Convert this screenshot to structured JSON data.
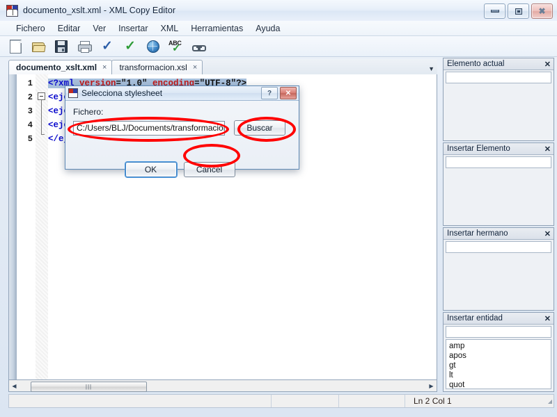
{
  "window": {
    "title": "documento_xslt.xml - XML Copy Editor",
    "app_icon": "xml-copy-editor-icon",
    "minimize_label": "Minimizar",
    "maximize_label": "Restaurar",
    "close_label": "Cerrar"
  },
  "menubar": {
    "items": [
      {
        "label": "Fichero",
        "name": "menu-fichero"
      },
      {
        "label": "Editar",
        "name": "menu-editar"
      },
      {
        "label": "Ver",
        "name": "menu-ver"
      },
      {
        "label": "Insertar",
        "name": "menu-insertar"
      },
      {
        "label": "XML",
        "name": "menu-xml"
      },
      {
        "label": "Herramientas",
        "name": "menu-herramientas"
      },
      {
        "label": "Ayuda",
        "name": "menu-ayuda"
      }
    ]
  },
  "toolbar": {
    "items": [
      {
        "icon": "new-document-icon"
      },
      {
        "icon": "open-folder-icon"
      },
      {
        "icon": "save-floppy-icon"
      },
      {
        "icon": "print-icon"
      },
      {
        "icon": "check-wellformed-icon"
      },
      {
        "icon": "check-validate-icon"
      },
      {
        "icon": "globe-preview-icon"
      },
      {
        "icon": "abc-spellcheck-icon"
      },
      {
        "icon": "link-icon"
      }
    ]
  },
  "tabs": {
    "items": [
      {
        "label": "documento_xslt.xml",
        "close": "×",
        "active": true
      },
      {
        "label": "transformacion.xsl",
        "close": "×",
        "active": false
      }
    ],
    "overflow_glyph": "▼"
  },
  "editor": {
    "line_numbers": [
      "1",
      "2",
      "3",
      "4",
      "5"
    ],
    "lines": [
      {
        "n": "1",
        "parts": [
          {
            "t": "<?xml ",
            "c": "tok-punct"
          },
          {
            "t": "version",
            "c": "tok-attr"
          },
          {
            "t": "=\"1.0\" ",
            "c": "tok-val"
          },
          {
            "t": "encoding",
            "c": "tok-attr"
          },
          {
            "t": "=\"UTF-8\"?>",
            "c": "tok-val"
          }
        ]
      },
      {
        "n": "2",
        "parts": [
          {
            "t": "<ejemplo>",
            "c": "tok-name"
          }
        ]
      },
      {
        "n": "3",
        "parts": [
          {
            "t": "  <ejem>uno</ejem>",
            "c": "tok-name"
          }
        ]
      },
      {
        "n": "4",
        "parts": [
          {
            "t": "  <ejem>dos</ejem>",
            "c": "tok-name"
          }
        ]
      },
      {
        "n": "5",
        "parts": [
          {
            "t": "</ejemplo>",
            "c": "tok-name"
          }
        ]
      }
    ],
    "fold_marker": "−",
    "scroll_left_arrow": "◀",
    "scroll_right_arrow": "▶",
    "scroll_grip": "|||"
  },
  "sidebar": {
    "panels": [
      {
        "title": "Elemento actual",
        "close": "✕",
        "name": "panel-elemento-actual",
        "has_list": false,
        "items": []
      },
      {
        "title": "Insertar Elemento",
        "close": "✕",
        "name": "panel-insertar-elemento",
        "has_list": false,
        "items": []
      },
      {
        "title": "Insertar hermano",
        "close": "✕",
        "name": "panel-insertar-hermano",
        "has_list": false,
        "items": []
      },
      {
        "title": "Insertar entidad",
        "close": "✕",
        "name": "panel-insertar-entidad",
        "has_list": true,
        "items": [
          "amp",
          "apos",
          "gt",
          "lt",
          "quot"
        ]
      }
    ]
  },
  "statusbar": {
    "cursor": "Ln 2 Col 1",
    "grip": "◢"
  },
  "dialog": {
    "title": "Selecciona stylesheet",
    "icon": "xml-copy-editor-icon",
    "help_glyph": "?",
    "close_glyph": "✕",
    "field_label": "Fichero:",
    "field_value": "C:/Users/BLJ/Documents/transformacion.xsl",
    "field_placeholder": "",
    "browse_label": "Buscar",
    "ok_label": "OK",
    "cancel_label": "Cancel"
  },
  "annotations": {
    "color": "#ff0000",
    "targets": [
      "file-path-input",
      "browse-button",
      "ok-button"
    ]
  }
}
